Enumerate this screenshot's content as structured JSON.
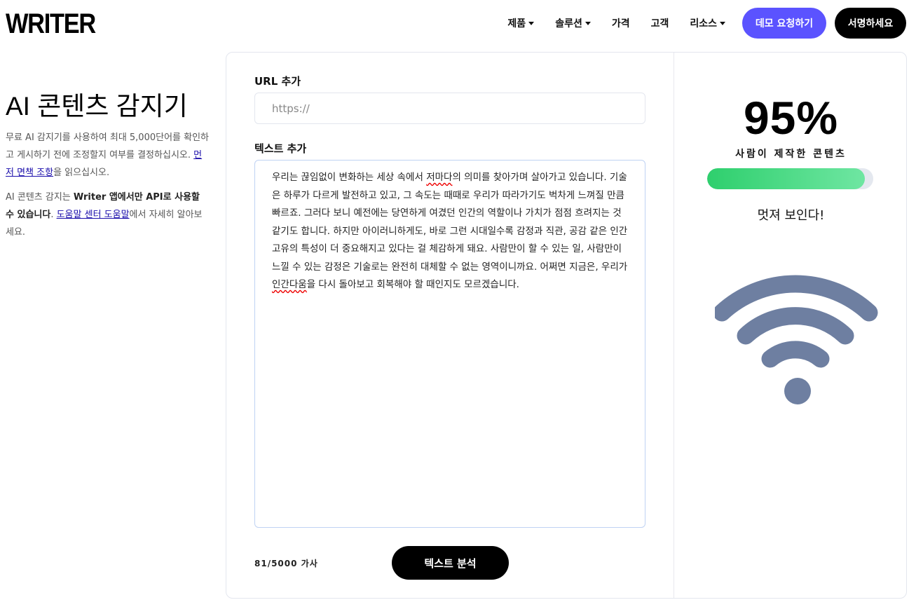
{
  "header": {
    "logo": "WRITER",
    "nav": [
      {
        "label": "제품",
        "dropdown": true
      },
      {
        "label": "솔루션",
        "dropdown": true
      },
      {
        "label": "가격",
        "dropdown": false
      },
      {
        "label": "고객",
        "dropdown": false
      },
      {
        "label": "리소스",
        "dropdown": true
      }
    ],
    "demo_button": "데모 요청하기",
    "signup_button": "서명하세요"
  },
  "left": {
    "title": "AI 콘텐츠 감지기",
    "p1_before": "무료 AI 감지기를 사용하여 최대 5,000단어를 확인하고 게시하기 전에 조정할지 여부를 결정하십시오. ",
    "p1_link": "먼저 면책 조항",
    "p1_after": "을 읽으십시오.",
    "p2_before": "AI 콘텐츠 감지는 ",
    "p2_bold": "Writer 앱에서만 API로 사용할 수 있습니다",
    "p2_mid": ". ",
    "p2_link": "도움말 센터 도움말",
    "p2_after": "에서 자세히 알아보세요."
  },
  "form": {
    "url_label": "URL 추가",
    "url_placeholder": "https://",
    "url_value": "",
    "text_label": "텍스트 추가",
    "text_part1": "우리는 끊임없이 변화하는 세상 속에서 ",
    "text_misspelled1": "저마다",
    "text_part2": "의 의미를 찾아가며 살아가고 있습니다. 기술은 하루가 다르게 발전하고 있고, 그 속도는 때때로 우리가 따라가기도 벅차게 느껴질 만큼 빠르죠. 그러다 보니 예전에는 당연하게 여겼던 인간의 역할이나 가치가 점점 흐려지는 것 같기도 합니다. 하지만 아이러니하게도, 바로 그런 시대일수록 감정과 직관, 공감 같은 인간 고유의 특성이 더 중요해지고 있다는 걸 체감하게 돼요. 사람만이 할 수 있는 일, 사람만이 느낄 수 있는 감정은 기술로는 완전히 대체할 수 없는 영역이니까요. 어쩌면 지금은, 우리가 ",
    "text_misspelled2": "인간다움",
    "text_part3": "을 다시 돌아보고 회복해야 할 때인지도 모르겠습니다.",
    "word_count": "81/5000 가사",
    "analyze_button": "텍스트 분석"
  },
  "result": {
    "percent": "95%",
    "human_label": "사람이 제작한 콘텐츠",
    "score_fraction": 0.95,
    "verdict": "멋져 보인다!",
    "icon": "wifi-icon",
    "icon_color": "#6e7fa1",
    "bar_color": "#2ecf6d"
  }
}
